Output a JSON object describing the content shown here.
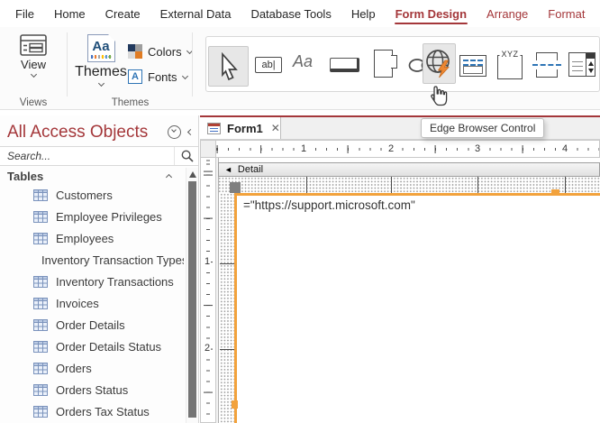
{
  "colors": {
    "accent": "#A4373A",
    "selection": "#F2A23C"
  },
  "menubar": {
    "items": [
      {
        "label": "File"
      },
      {
        "label": "Home"
      },
      {
        "label": "Create"
      },
      {
        "label": "External Data"
      },
      {
        "label": "Database Tools"
      },
      {
        "label": "Help"
      },
      {
        "label": "Form Design"
      },
      {
        "label": "Arrange"
      },
      {
        "label": "Format"
      }
    ]
  },
  "ribbon": {
    "view_label": "View",
    "views_group_label": "Views",
    "themes_label": "Themes",
    "themes_glyph": "Aa",
    "colors_label": "Colors",
    "fonts_label": "Fonts",
    "fonts_glyph": "A",
    "themes_group_label": "Themes",
    "textbox_glyph": "ab|",
    "label_glyph": "Aa",
    "option_group_glyph": "XYZ"
  },
  "tooltip": "Edge Browser Control",
  "sidebar": {
    "title": "All Access Objects",
    "search_placeholder": "Search...",
    "section_label": "Tables",
    "tables": [
      "Customers",
      "Employee Privileges",
      "Employees",
      "Inventory Transaction Types",
      "Inventory Transactions",
      "Invoices",
      "Order Details",
      "Order Details Status",
      "Orders",
      "Orders Status",
      "Orders Tax Status"
    ]
  },
  "document": {
    "tab_label": "Form1",
    "close_glyph": "✕",
    "section_header": "Detail",
    "control_text": "=\"https://support.microsoft.com\"",
    "hruler": [
      "1",
      "2",
      "3",
      "4"
    ],
    "vruler": [
      "1",
      "2"
    ]
  }
}
